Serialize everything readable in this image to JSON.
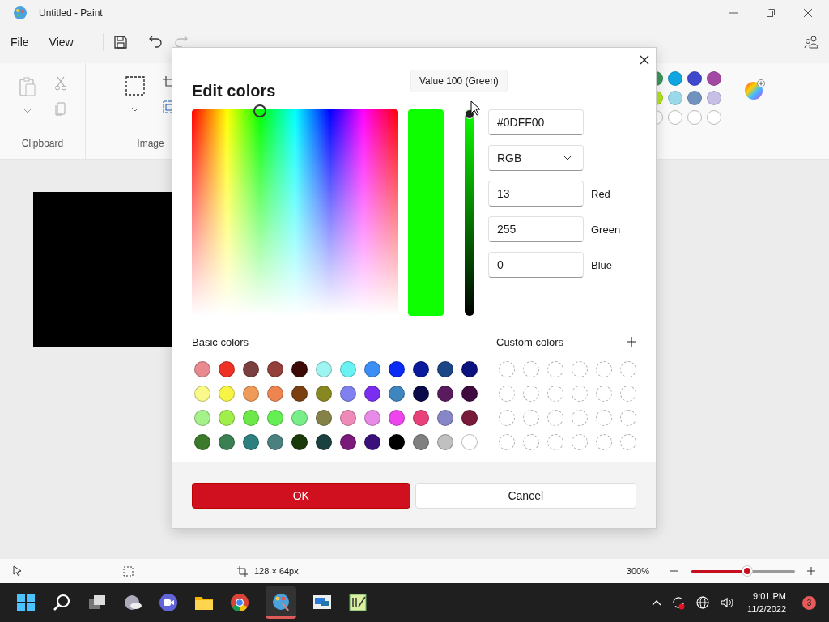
{
  "window": {
    "title": "Untitled - Paint"
  },
  "menu": [
    "File",
    "View"
  ],
  "ribbon": {
    "groups": [
      "Clipboard",
      "Image"
    ],
    "palette": [
      [
        {
          "color": "#3a9a5a"
        },
        {
          "color": "#0ea5e0"
        },
        {
          "color": "#3f48cc"
        },
        {
          "color": "#a349a4"
        }
      ],
      [
        {
          "color": "#b5e61d"
        },
        {
          "color": "#99d9ea"
        },
        {
          "color": "#7092be"
        },
        {
          "color": "#c8bfe7"
        }
      ],
      [
        {
          "kind": "empty"
        },
        {
          "kind": "empty"
        },
        {
          "kind": "empty"
        },
        {
          "kind": "empty"
        }
      ]
    ]
  },
  "dialog": {
    "title": "Edit colors",
    "tooltip": "Value 100 (Green)",
    "value_slider": {
      "level": 1
    },
    "hex": "#0DFF00",
    "mode": "RGB",
    "channels": [
      {
        "value": "13",
        "label": "Red"
      },
      {
        "value": "255",
        "label": "Green"
      },
      {
        "value": "0",
        "label": "Blue"
      }
    ],
    "basic_label": "Basic colors",
    "basic_colors": [
      {
        "color": "#e88a8f"
      },
      {
        "color": "#ee3124"
      },
      {
        "color": "#7b3f3f"
      },
      {
        "color": "#94403a"
      },
      {
        "color": "#3d0b07"
      },
      {
        "color": "#9ef4f0"
      },
      {
        "color": "#6af2f2"
      },
      {
        "color": "#3a8ef5"
      },
      {
        "color": "#0a2af5"
      },
      {
        "color": "#0a1a9c"
      },
      {
        "color": "#1b4686"
      },
      {
        "color": "#0a127e"
      },
      {
        "color": "#fafa8a"
      },
      {
        "color": "#f8f443"
      },
      {
        "color": "#ee9a58"
      },
      {
        "color": "#ee8450"
      },
      {
        "color": "#7a4012"
      },
      {
        "color": "#888822"
      },
      {
        "color": "#8080f0"
      },
      {
        "color": "#7a2ef0"
      },
      {
        "color": "#3d86c0"
      },
      {
        "color": "#0a0a4a"
      },
      {
        "color": "#5a1a5e"
      },
      {
        "color": "#3f0a3f"
      },
      {
        "color": "#a6f28a"
      },
      {
        "color": "#a0ee48"
      },
      {
        "color": "#6ce848"
      },
      {
        "color": "#66ee55"
      },
      {
        "color": "#78ee88"
      },
      {
        "color": "#858248"
      },
      {
        "color": "#ee8ab8"
      },
      {
        "color": "#e88ae8"
      },
      {
        "color": "#ee44ee"
      },
      {
        "color": "#e8407a"
      },
      {
        "color": "#8787c8"
      },
      {
        "color": "#7a1a3a"
      },
      {
        "color": "#3a7a2a"
      },
      {
        "color": "#3a8052"
      },
      {
        "color": "#2e8080"
      },
      {
        "color": "#4a8080"
      },
      {
        "color": "#1a3a0a"
      },
      {
        "color": "#1a4040"
      },
      {
        "color": "#7a1a7a"
      },
      {
        "color": "#3a107a"
      },
      {
        "color": "#000000"
      },
      {
        "color": "#808080"
      },
      {
        "color": "#c0c0c0"
      },
      {
        "color": "#ffffff"
      }
    ],
    "custom_label": "Custom colors",
    "custom_colors": [
      {
        "filled": false
      },
      {
        "filled": false
      },
      {
        "filled": false
      },
      {
        "filled": false
      },
      {
        "filled": false
      },
      {
        "filled": false
      },
      {
        "filled": false
      },
      {
        "filled": false
      },
      {
        "filled": false
      },
      {
        "filled": false
      },
      {
        "filled": false
      },
      {
        "filled": false
      },
      {
        "filled": false
      },
      {
        "filled": false
      },
      {
        "filled": false
      },
      {
        "filled": false
      },
      {
        "filled": false
      },
      {
        "filled": false
      },
      {
        "filled": false
      },
      {
        "filled": false
      },
      {
        "filled": false
      },
      {
        "filled": false
      },
      {
        "filled": false
      },
      {
        "filled": false
      }
    ],
    "buttons": [
      {
        "label": "OK",
        "kind": "primary"
      },
      {
        "label": "Cancel",
        "kind": "secondary"
      }
    ]
  },
  "status_bar": {
    "size": "128 × 64px",
    "zoom": "300%",
    "zoom_slider": {
      "level": 0.54
    }
  },
  "taskbar": {
    "time": "9:01 PM",
    "date": "11/2/2022",
    "badge": "3"
  }
}
